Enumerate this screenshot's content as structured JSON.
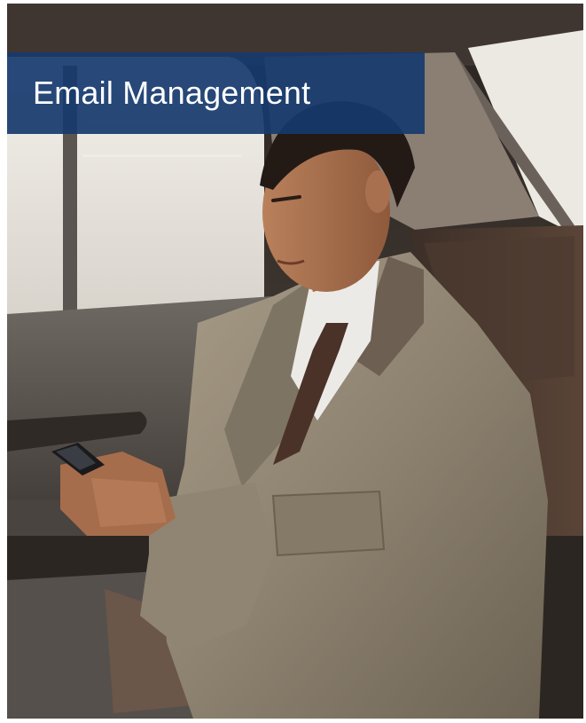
{
  "banner": {
    "title": "Email Management",
    "background_color": "#163a6e",
    "text_color": "#ffffff"
  },
  "photo": {
    "subject": "man-in-suit-using-smartphone-in-car-back-seat"
  }
}
